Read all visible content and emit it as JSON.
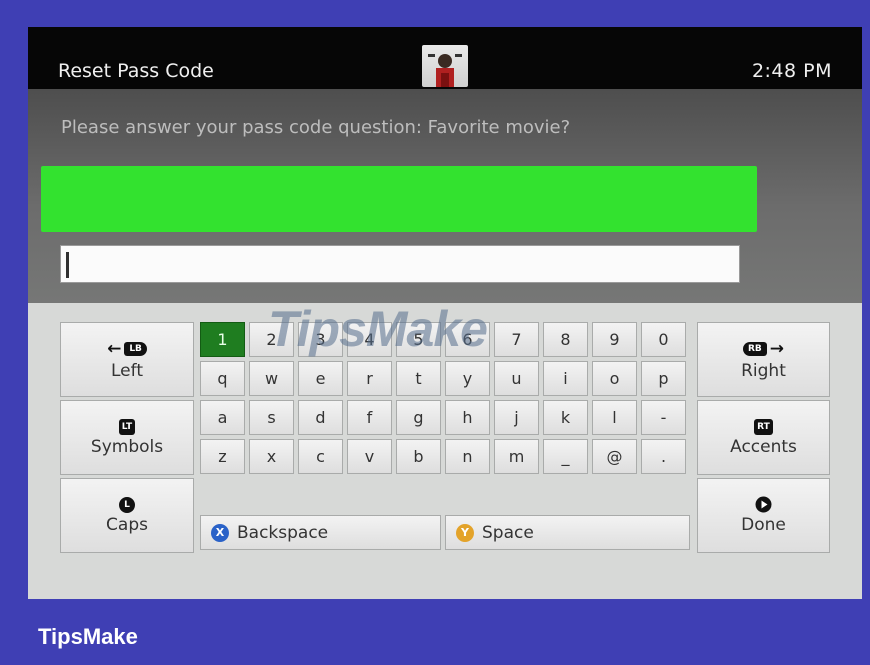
{
  "header": {
    "title": "Reset Pass Code",
    "time": "2:48 PM"
  },
  "prompt": {
    "text": "Please answer your pass code question: Favorite movie?"
  },
  "input": {
    "value": ""
  },
  "keyboard": {
    "left": {
      "label": "Left",
      "button": "LB"
    },
    "symbols": {
      "label": "Symbols",
      "button": "LT"
    },
    "caps": {
      "label": "Caps",
      "button": "L"
    },
    "right": {
      "label": "Right",
      "button": "RB"
    },
    "accents": {
      "label": "Accents",
      "button": "RT"
    },
    "done": {
      "label": "Done"
    },
    "rows": [
      [
        "1",
        "2",
        "3",
        "4",
        "5",
        "6",
        "7",
        "8",
        "9",
        "0"
      ],
      [
        "q",
        "w",
        "e",
        "r",
        "t",
        "y",
        "u",
        "i",
        "o",
        "p"
      ],
      [
        "a",
        "s",
        "d",
        "f",
        "g",
        "h",
        "j",
        "k",
        "l",
        "-"
      ],
      [
        "z",
        "x",
        "c",
        "v",
        "b",
        "n",
        "m",
        "_",
        "@",
        "."
      ]
    ],
    "selected_key": "1",
    "backspace": {
      "label": "Backspace",
      "button": "X",
      "color": "#2a62c8"
    },
    "space": {
      "label": "Space",
      "button": "Y",
      "color": "#e3a32a"
    }
  },
  "colors": {
    "highlight": "#33e22f",
    "selected_key": "#1f7d20",
    "page_bg": "#3f3fb4"
  },
  "watermark": "TipsMake",
  "footer": {
    "brand": "TipsMake"
  }
}
